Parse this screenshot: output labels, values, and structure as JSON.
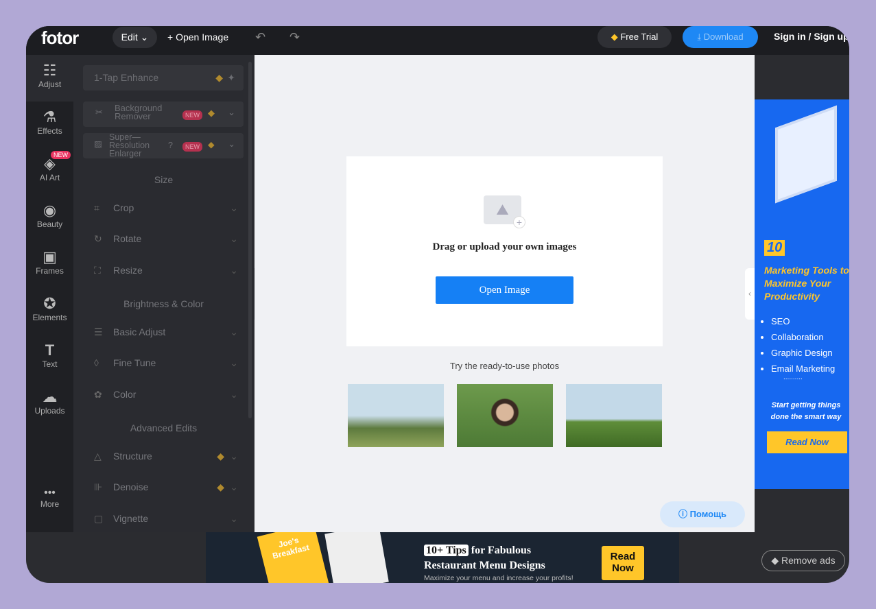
{
  "topbar": {
    "logo": "fotor",
    "edit": "Edit ⌄",
    "open_image": "+ Open Image",
    "free_trial": "Free Trial",
    "download": "Download",
    "sign_in": "Sign in / Sign up"
  },
  "rail": [
    {
      "label": "Adjust",
      "icon": "☷"
    },
    {
      "label": "Effects",
      "icon": "⚗"
    },
    {
      "label": "AI Art",
      "icon": "◈",
      "badge": "NEW"
    },
    {
      "label": "Beauty",
      "icon": "◉"
    },
    {
      "label": "Frames",
      "icon": "▣"
    },
    {
      "label": "Elements",
      "icon": "✪"
    },
    {
      "label": "Text",
      "icon": "T"
    },
    {
      "label": "Uploads",
      "icon": "☁"
    },
    {
      "label": "More",
      "icon": "•••"
    }
  ],
  "panel": {
    "enhance": "1-Tap Enhance",
    "bg_remover": "Background Remover",
    "super_res": "Super—Resolution Enlarger",
    "new_badge": "NEW",
    "size": "Size",
    "crop": "Crop",
    "rotate": "Rotate",
    "resize": "Resize",
    "brightness": "Brightness & Color",
    "basic_adjust": "Basic Adjust",
    "fine_tune": "Fine Tune",
    "color": "Color",
    "advanced": "Advanced Edits",
    "structure": "Structure",
    "denoise": "Denoise",
    "vignette": "Vignette"
  },
  "canvas": {
    "drag_text": "Drag or upload your own images",
    "open_button": "Open Image",
    "try_text": "Try the ready-to-use photos",
    "help": "Помощь"
  },
  "side_ad": {
    "number": "10",
    "title": "Marketing Tools to Maximize Your Productivity",
    "bullets": [
      "SEO",
      "Collaboration",
      "Graphic Design",
      "Email Marketing"
    ],
    "ellipsis": "..........",
    "tagline": "Start getting things done the smart way",
    "cta": "Read Now"
  },
  "bottom_ad": {
    "menu_title": "Joe's Breakfast",
    "tips": "10+ Tips",
    "line1": "for Fabulous",
    "line2": "Restaurant Menu Designs",
    "sub": "Maximize your menu and increase your profits!",
    "cta": "Read Now"
  },
  "remove_ads": "Remove ads",
  "colors": {
    "accent": "#1e88f5",
    "ad_blue": "#1768f0",
    "ad_yellow": "#ffc629"
  }
}
